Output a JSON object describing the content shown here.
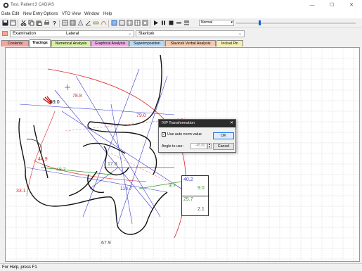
{
  "window": {
    "title": "Test, Patient:3 CADIAS"
  },
  "menu": [
    "Data",
    "Edit",
    "New Entry",
    "Options",
    "VTO",
    "View",
    "Window",
    "Help"
  ],
  "toolbar": {
    "zoom_value": "Normal",
    "icons": [
      "save-icon",
      "print-preview-icon",
      "cut-icon",
      "copy-icon",
      "paste-icon",
      "print-icon",
      "help-icon",
      "grid-icon",
      "grid-icon",
      "scale-icon",
      "angle-icon",
      "ruler-icon",
      "tracing-icon",
      "superimpose-icon",
      "grid-fine-icon",
      "grid-dots-icon",
      "overlay-icon",
      "play-icon",
      "pause-icon",
      "stop-icon",
      "minus-icon",
      "list-icon"
    ]
  },
  "selectors": {
    "examination": "Examination",
    "view": "Lateral",
    "analysis": "Slavicek"
  },
  "tabs": [
    {
      "label": "Contents",
      "color": "#f4a5a0"
    },
    {
      "label": "Tracings",
      "color": "#ffffff"
    },
    {
      "label": "Numerical Analysis",
      "color": "#d7f19a"
    },
    {
      "label": "Graphical Analysis",
      "color": "#f3a6e4"
    },
    {
      "label": "Superimposition",
      "color": "#b6d8f5"
    },
    {
      "label": "Slavicek Verbal Analysis",
      "color": "#f8c7a8"
    },
    {
      "label": "Incisal Pin",
      "color": "#f5f0a8"
    }
  ],
  "active_tab": "Tracings",
  "measurements": {
    "m1": {
      "value": "69.0",
      "color": "#222222"
    },
    "m2": {
      "value": "78.8",
      "color": "#d03030"
    },
    "m3": {
      "value": "79.0",
      "color": "#d03030"
    },
    "m4": {
      "value": "44.9",
      "color": "#d03030"
    },
    "m5": {
      "value": "48.7",
      "color": "#2f9a2f"
    },
    "m6": {
      "value": "17.3",
      "color": "#666666"
    },
    "m7": {
      "value": "114.7",
      "color": "#3a3ad0"
    },
    "m8": {
      "value": "3.7",
      "color": "#2f9a2f"
    },
    "m9": {
      "value": "33.1",
      "color": "#d03030"
    },
    "m10": {
      "value": "67.9",
      "color": "#444444"
    }
  },
  "measure_box": {
    "v1": {
      "value": "40.2",
      "color": "#3a3ad0"
    },
    "v2": {
      "value": "9.0",
      "color": "#2f9a2f"
    },
    "v3": {
      "value": "25.7",
      "color": "#2f9a2f"
    },
    "v4": {
      "value": "2.1",
      "color": "#555555"
    }
  },
  "dialog": {
    "title": "IVP Transformation",
    "checkbox_label": "Use auto norm value",
    "checkbox_checked": true,
    "angle_label": "Angle to use:",
    "angle_value": "-45.00",
    "ok_label": "OK",
    "cancel_label": "Cancel"
  },
  "status": {
    "text": "For Help, press F1"
  }
}
